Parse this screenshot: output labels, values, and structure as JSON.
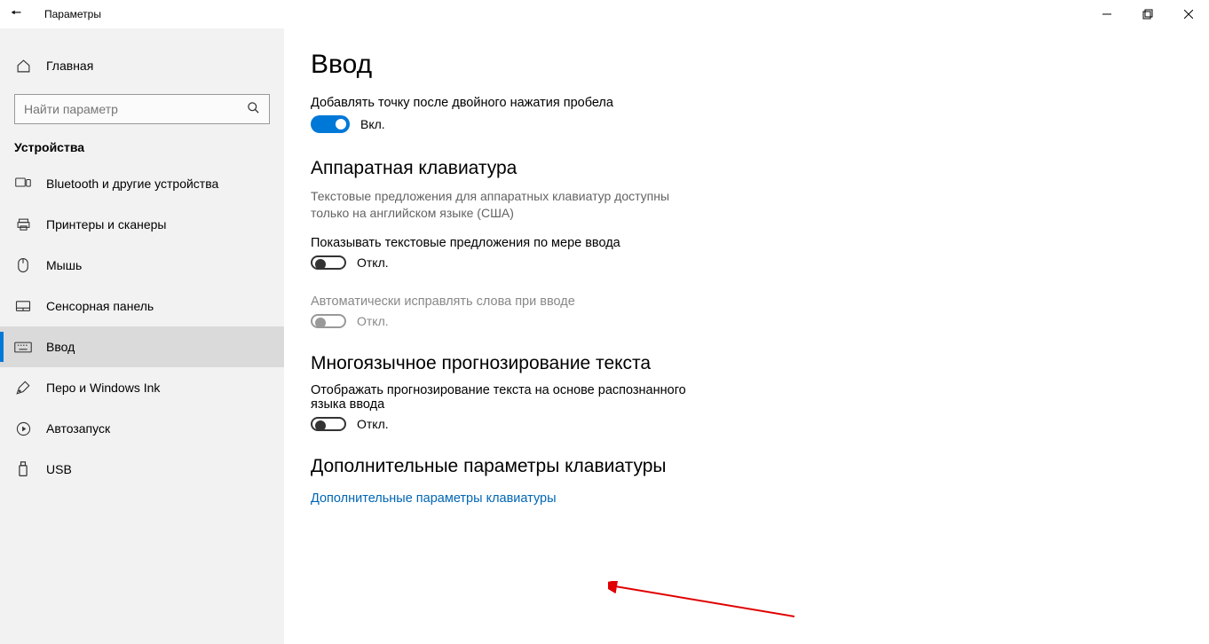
{
  "window": {
    "title": "Параметры"
  },
  "sidebar": {
    "home": "Главная",
    "search_placeholder": "Найти параметр",
    "category": "Устройства",
    "items": [
      {
        "label": "Bluetooth и другие устройства"
      },
      {
        "label": "Принтеры и сканеры"
      },
      {
        "label": "Мышь"
      },
      {
        "label": "Сенсорная панель"
      },
      {
        "label": "Ввод"
      },
      {
        "label": "Перо и Windows Ink"
      },
      {
        "label": "Автозапуск"
      },
      {
        "label": "USB"
      }
    ]
  },
  "main": {
    "title": "Ввод",
    "setting_space": {
      "label": "Добавлять точку после двойного нажатия пробела",
      "state": "Вкл."
    },
    "hw": {
      "heading": "Аппаратная клавиатура",
      "desc": "Текстовые предложения для аппаратных клавиатур доступны только на английском языке (США)",
      "suggest_label": "Показывать текстовые предложения по мере ввода",
      "suggest_state": "Откл.",
      "autocorrect_label": "Автоматически исправлять слова при вводе",
      "autocorrect_state": "Откл."
    },
    "multilang": {
      "heading": "Многоязычное прогнозирование текста",
      "desc": "Отображать прогнозирование текста на основе распознанного языка ввода",
      "state": "Откл."
    },
    "advanced": {
      "heading": "Дополнительные параметры клавиатуры",
      "link": "Дополнительные параметры клавиатуры"
    }
  }
}
